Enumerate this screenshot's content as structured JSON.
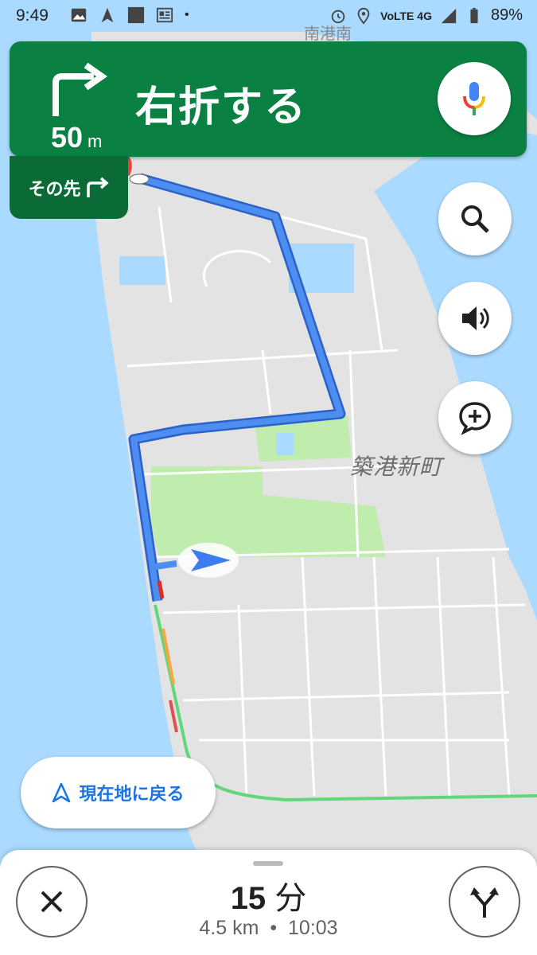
{
  "status_bar": {
    "time": "9:49",
    "network": "VoLTE 4G",
    "battery": "89%",
    "dot": "•"
  },
  "nav_header": {
    "distance_value": "50",
    "distance_unit": "m",
    "instruction": "右折する",
    "then_label": "その先",
    "turn_icon": "turn-right-icon"
  },
  "map": {
    "area_label": "築港新町",
    "top_label": "南港南",
    "colors": {
      "water": "#aadaff",
      "land": "#e0e0e0",
      "park": "#c0ecae",
      "route": "#4285f4"
    }
  },
  "controls": {
    "search": "search-icon",
    "sound": "volume-icon",
    "report": "add-comment-icon"
  },
  "recenter": {
    "label": "現在地に戻る"
  },
  "trip": {
    "minutes": "15",
    "min_unit": "分",
    "distance": "4.5 km",
    "separator": "•",
    "arrival": "10:03"
  }
}
